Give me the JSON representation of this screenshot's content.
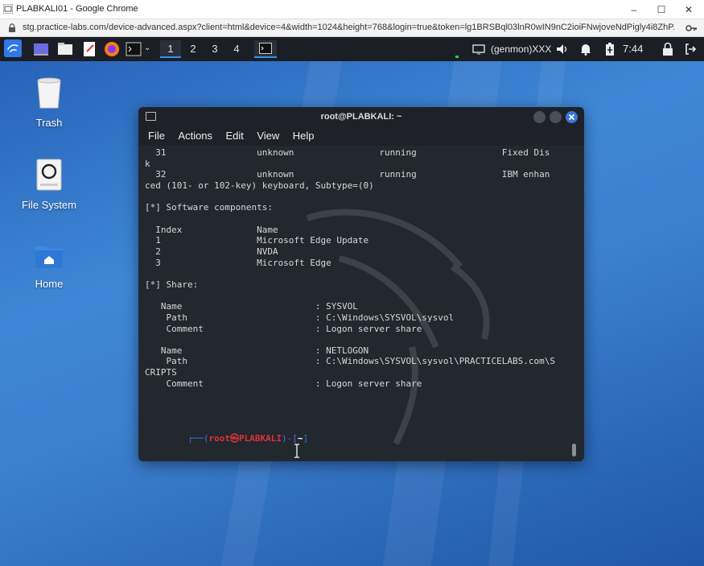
{
  "browser": {
    "window_title": "PLABKALI01 - Google Chrome",
    "url": "stg.practice-labs.com/device-advanced.aspx?client=html&device=4&width=1024&height=768&login=true&token=lg1BRSBql03lnR0wIN9nC2ioiFNwjoveNdPigly4i8ZhP...",
    "minimize_label": "–",
    "maximize_label": "☐",
    "close_label": "✕"
  },
  "panel": {
    "workspaces": [
      "1",
      "2",
      "3",
      "4"
    ],
    "genmon": "(genmon)XXX",
    "clock": "7:44"
  },
  "desktop": {
    "icons": [
      {
        "label": "Trash",
        "icon": "trash-icon"
      },
      {
        "label": "File System",
        "icon": "drive-icon"
      },
      {
        "label": "Home",
        "icon": "home-folder-icon"
      }
    ]
  },
  "terminal": {
    "title": "root@PLABKALI: ~",
    "menu": [
      "File",
      "Actions",
      "Edit",
      "View",
      "Help"
    ],
    "output": "  31                 unknown                running                Fixed Dis\nk\n  32                 unknown                running                IBM enhan\nced (101- or 102-key) keyboard, Subtype=(0)\n\n[*] Software components:\n\n  Index              Name\n  1                  Microsoft Edge Update\n  2                  NVDA\n  3                  Microsoft Edge\n\n[*] Share:\n\n   Name                         : SYSVOL\n    Path                        : C:\\Windows\\SYSVOL\\sysvol\n    Comment                     : Logon server share\n\n   Name                         : NETLOGON\n    Path                        : C:\\Windows\\SYSVOL\\sysvol\\PRACTICELABS.com\\S\nCRIPTS\n    Comment                     : Logon server share",
    "prompt_user": "root㉿PLABKALI",
    "prompt_dir": "~",
    "prompt_symbol": "#"
  },
  "colors": {
    "prompt_red": "#e0313a",
    "prompt_blue": "#3a78d8",
    "terminal_bg": "#23272e",
    "panel_bg": "#1b1e25"
  }
}
